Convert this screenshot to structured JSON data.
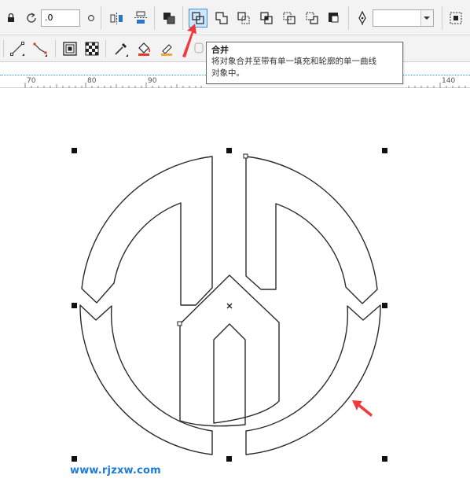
{
  "toolbar": {
    "rotation_value": ".0",
    "outline_width_value": ""
  },
  "tooltip": {
    "title": "合并",
    "description_line1": "将对象合并至带有单一填充和轮廓的单一曲线",
    "description_line2": "对象中。"
  },
  "ruler": {
    "labels": [
      "70",
      "80",
      "90",
      "140"
    ]
  },
  "watermark": "www.rjzxw.com",
  "colors": {
    "toolbar_bg": "#f3f3f3",
    "active_button": "#cde8ff",
    "annotation_arrow": "#f0393c",
    "outline": "#2a2a2a",
    "watermark": "#1d7bd6"
  },
  "icons": {
    "lock": "lock-icon",
    "rotate": "rotate-icon",
    "mirror_h": "mirror-horizontal-icon",
    "mirror_v": "mirror-vertical-icon",
    "order": "order-icon",
    "combine": "combine-icon",
    "weld": "weld-icon",
    "trim": "trim-icon",
    "intersect": "intersect-icon",
    "simplify": "simplify-icon",
    "front_minus_back": "front-minus-back-icon",
    "back_minus_front": "back-minus-front-icon",
    "create_boundary": "create-boundary-icon",
    "pen": "pen-nib-icon"
  }
}
